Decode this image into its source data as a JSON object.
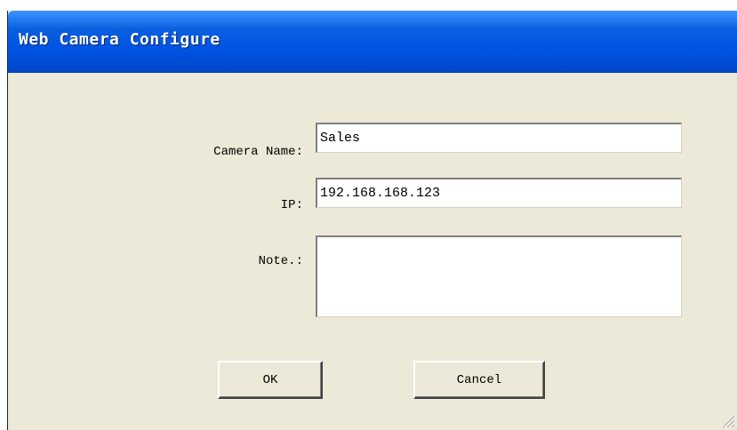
{
  "window": {
    "title": "Web Camera Configure"
  },
  "form": {
    "camera_name_label": "Camera Name:",
    "camera_name_value": "Sales",
    "ip_label": "IP:",
    "ip_value": "192.168.168.123",
    "note_label": "Note.:",
    "note_value": ""
  },
  "buttons": {
    "ok_label": "OK",
    "cancel_label": "Cancel"
  },
  "colors": {
    "titlebar": "#0054e3",
    "dialog_bg": "#ece9d8",
    "title_text": "#ffffff"
  },
  "icons": {
    "resize_grip": "resize-grip-icon"
  }
}
